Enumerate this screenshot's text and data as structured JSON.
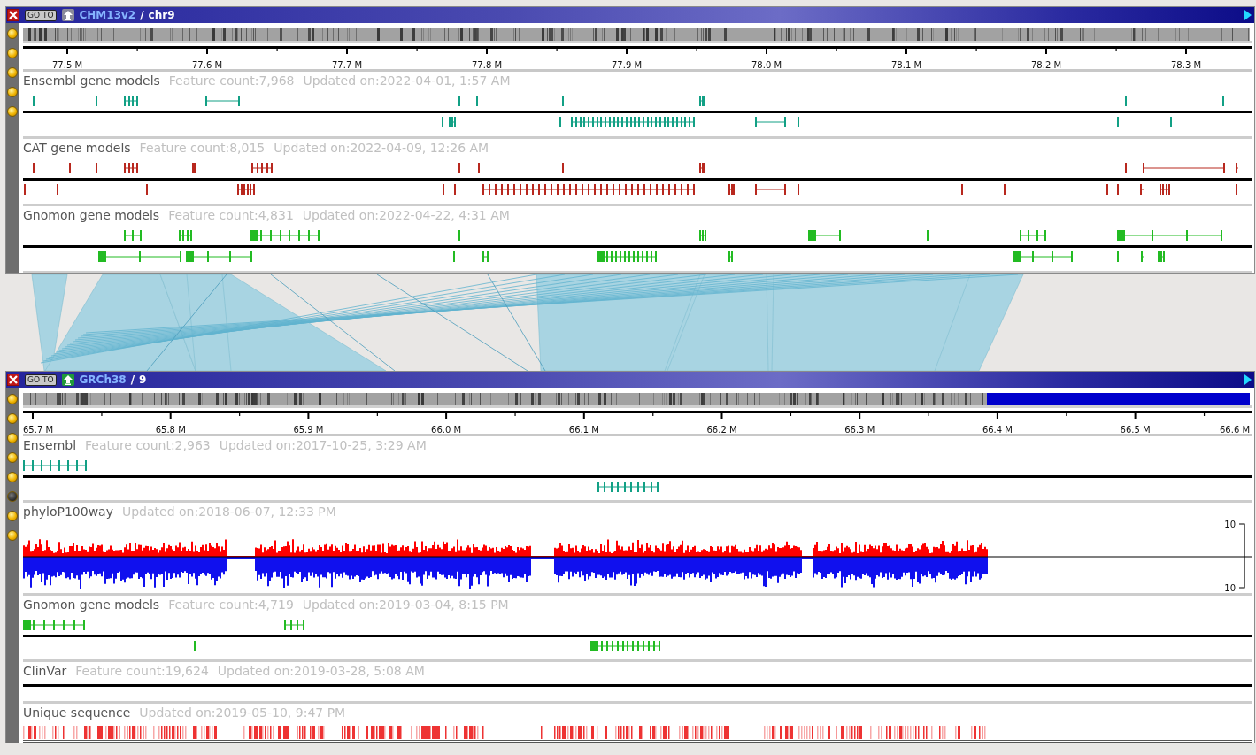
{
  "panels": [
    {
      "assembly": "CHM13v2",
      "separator": "/",
      "chromosome": "chr9",
      "goto_label": "GO TO",
      "up_enabled": false,
      "side_buttons": [
        {
          "active": false
        },
        {
          "active": false
        },
        {
          "active": false
        },
        {
          "active": false
        },
        {
          "active": false
        }
      ],
      "ruler_labels": [
        "77.5 M",
        "77.6 M",
        "77.7 M",
        "77.8 M",
        "77.9 M",
        "78.0 M",
        "78.1 M",
        "78.2 M",
        "78.3 M"
      ],
      "tracks": [
        {
          "kind": "gene",
          "name": "Ensembl gene models",
          "feature_count": "Feature count:7,968",
          "updated": "Updated on:2022-04-01, 1:57 AM",
          "color": "#12a085"
        },
        {
          "kind": "gene",
          "name": "CAT gene models",
          "feature_count": "Feature count:8,015",
          "updated": "Updated on:2022-04-09, 12:26 AM",
          "color": "#b8281e"
        },
        {
          "kind": "gene",
          "name": "Gnomon gene models",
          "feature_count": "Feature count:4,831",
          "updated": "Updated on:2022-04-22, 4:31 AM",
          "color": "#22bb22"
        }
      ]
    },
    {
      "assembly": "GRCh38",
      "separator": "/",
      "chromosome": "9",
      "goto_label": "GO TO",
      "up_enabled": true,
      "side_buttons": [
        {
          "active": false
        },
        {
          "active": false
        },
        {
          "active": false
        },
        {
          "active": false
        },
        {
          "active": false
        },
        {
          "active": true
        },
        {
          "active": false
        },
        {
          "active": false
        }
      ],
      "ruler_labels": [
        "65.7 M",
        "65.8 M",
        "65.9 M",
        "66.0 M",
        "66.1 M",
        "66.2 M",
        "66.3 M",
        "66.4 M",
        "66.5 M",
        "66.6 M"
      ],
      "tracks": [
        {
          "kind": "gene",
          "name": "Ensembl",
          "feature_count": "Feature count:2,963",
          "updated": "Updated on:2017-10-25, 3:29 AM",
          "color": "#12a085"
        },
        {
          "kind": "wiggle",
          "name": "phyloP100way",
          "updated": "Updated on:2018-06-07, 12:33 PM",
          "axis_max": "10",
          "axis_min": "-10"
        },
        {
          "kind": "gene",
          "name": "Gnomon gene models",
          "feature_count": "Feature count:4,719",
          "updated": "Updated on:2019-03-04, 8:15 PM",
          "color": "#22bb22"
        },
        {
          "kind": "gene",
          "name": "ClinVar",
          "feature_count": "Feature count:19,624",
          "updated": "Updated on:2019-03-28, 5:08 AM"
        },
        {
          "kind": "density",
          "name": "Unique sequence",
          "updated": "Updated on:2019-05-10, 9:47 PM",
          "color": "#ee3333"
        }
      ]
    }
  ]
}
